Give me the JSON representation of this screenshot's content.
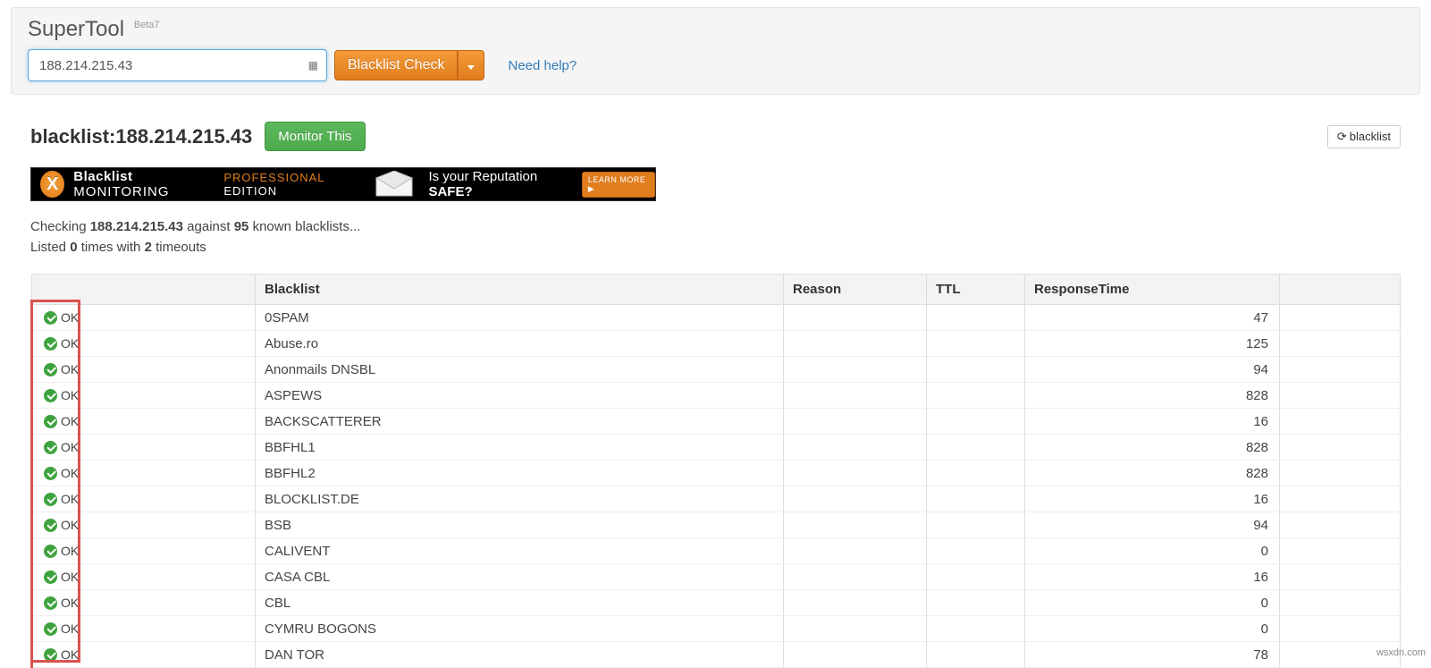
{
  "tool": {
    "name": "SuperTool",
    "tag": "Beta7"
  },
  "input": {
    "value": "188.214.215.43"
  },
  "actions": {
    "check_label": "Blacklist Check",
    "help_label": "Need help?"
  },
  "page": {
    "title": "blacklist:188.214.215.43",
    "monitor_btn": "Monitor This",
    "refresh_btn": "blacklist"
  },
  "promo": {
    "brand_a": "Blacklist",
    "brand_b": "MONITORING",
    "pro": "PROFESSIONAL",
    "edition": "EDITION",
    "question_a": "Is your Reputation",
    "question_b": "SAFE?",
    "learn": "LEARN MORE ▶"
  },
  "summary": {
    "line1_a": "Checking",
    "line1_ip": "188.214.215.43",
    "line1_b": "against",
    "line1_cnt": "95",
    "line1_c": "known blacklists...",
    "line2_a": "Listed",
    "line2_v1": "0",
    "line2_b": "times with",
    "line2_v2": "2",
    "line2_c": "timeouts"
  },
  "table": {
    "headers": {
      "status": "",
      "blacklist": "Blacklist",
      "reason": "Reason",
      "ttl": "TTL",
      "responsetime": "ResponseTime",
      "extra": ""
    },
    "rows": [
      {
        "status": "OK",
        "blacklist": "0SPAM",
        "reason": "",
        "ttl": "",
        "responsetime": "47"
      },
      {
        "status": "OK",
        "blacklist": "Abuse.ro",
        "reason": "",
        "ttl": "",
        "responsetime": "125"
      },
      {
        "status": "OK",
        "blacklist": "Anonmails DNSBL",
        "reason": "",
        "ttl": "",
        "responsetime": "94"
      },
      {
        "status": "OK",
        "blacklist": "ASPEWS",
        "reason": "",
        "ttl": "",
        "responsetime": "828"
      },
      {
        "status": "OK",
        "blacklist": "BACKSCATTERER",
        "reason": "",
        "ttl": "",
        "responsetime": "16"
      },
      {
        "status": "OK",
        "blacklist": "BBFHL1",
        "reason": "",
        "ttl": "",
        "responsetime": "828"
      },
      {
        "status": "OK",
        "blacklist": "BBFHL2",
        "reason": "",
        "ttl": "",
        "responsetime": "828"
      },
      {
        "status": "OK",
        "blacklist": "BLOCKLIST.DE",
        "reason": "",
        "ttl": "",
        "responsetime": "16"
      },
      {
        "status": "OK",
        "blacklist": "BSB",
        "reason": "",
        "ttl": "",
        "responsetime": "94"
      },
      {
        "status": "OK",
        "blacklist": "CALIVENT",
        "reason": "",
        "ttl": "",
        "responsetime": "0"
      },
      {
        "status": "OK",
        "blacklist": "CASA CBL",
        "reason": "",
        "ttl": "",
        "responsetime": "16"
      },
      {
        "status": "OK",
        "blacklist": "CBL",
        "reason": "",
        "ttl": "",
        "responsetime": "0"
      },
      {
        "status": "OK",
        "blacklist": "CYMRU BOGONS",
        "reason": "",
        "ttl": "",
        "responsetime": "0"
      },
      {
        "status": "OK",
        "blacklist": "DAN TOR",
        "reason": "",
        "ttl": "",
        "responsetime": "78"
      }
    ]
  },
  "watermark": "wsxdn.com"
}
